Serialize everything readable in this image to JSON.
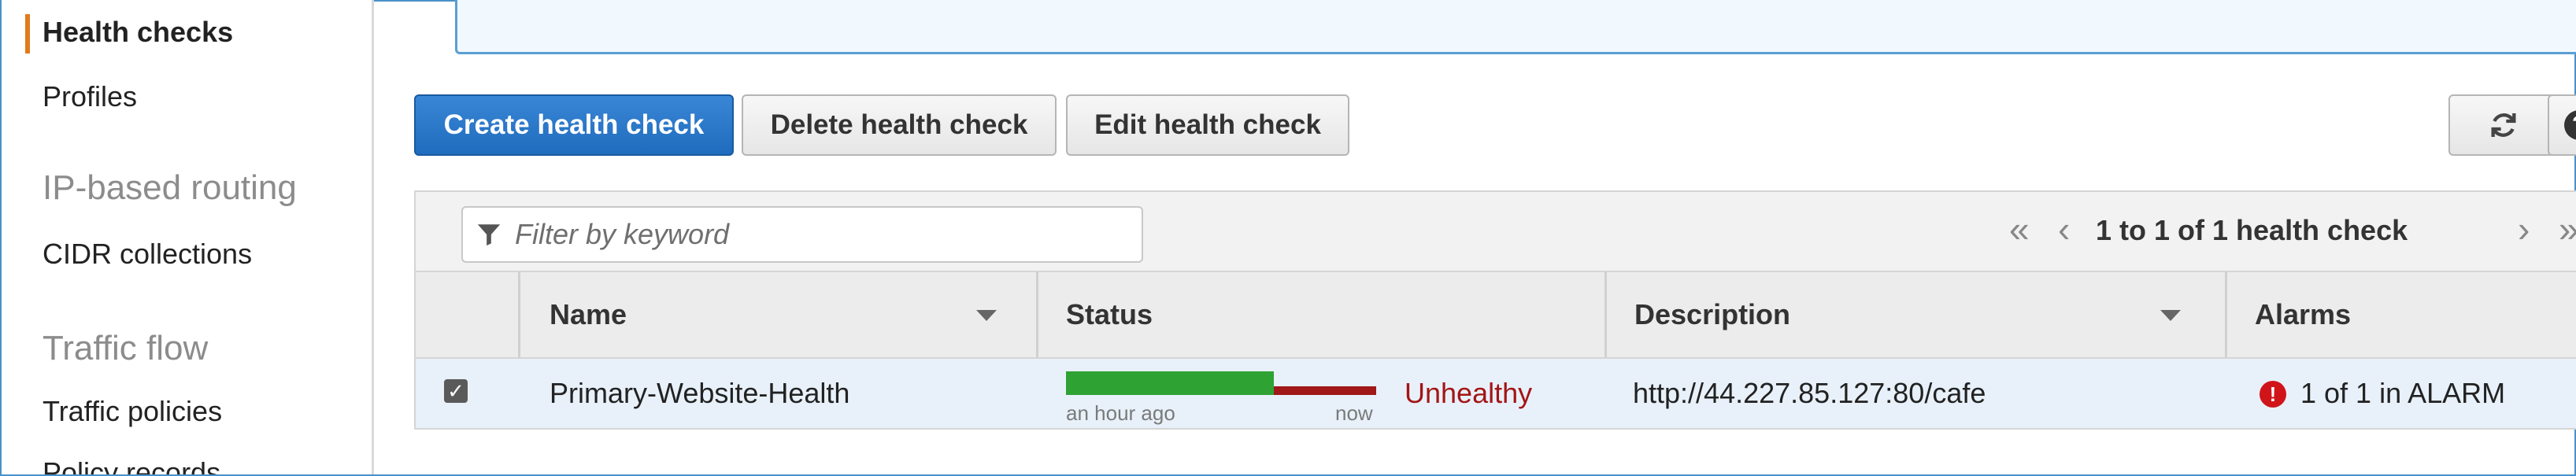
{
  "sidebar": {
    "items": [
      {
        "label": "Health checks",
        "active": true
      },
      {
        "label": "Profiles"
      },
      {
        "label": "CIDR collections"
      },
      {
        "label": "Traffic policies"
      },
      {
        "label": "Policy records"
      }
    ],
    "sections": [
      "IP-based routing",
      "Traffic flow"
    ]
  },
  "actions": {
    "create_label": "Create health check",
    "delete_label": "Delete health check",
    "edit_label": "Edit health check"
  },
  "filter": {
    "placeholder": "Filter by keyword",
    "value": ""
  },
  "pagination": {
    "text": "1 to 1 of 1 health check"
  },
  "table": {
    "columns": [
      "Name",
      "Status",
      "Description",
      "Alarms"
    ],
    "rows": [
      {
        "selected": true,
        "name": "Primary-Website-Health",
        "status_start_label": "an hour ago",
        "status_end_label": "now",
        "status": "Unhealthy",
        "description": "http://44.227.85.127:80/cafe",
        "alarms": "1 of 1 in ALARM"
      }
    ]
  },
  "colors": {
    "primary": "#1f6bbd",
    "accent_active": "#e07b1a",
    "healthy": "#2ea233",
    "unhealthy": "#a01818",
    "alarm": "#d0141a",
    "selected_row": "#e8f1fa"
  }
}
